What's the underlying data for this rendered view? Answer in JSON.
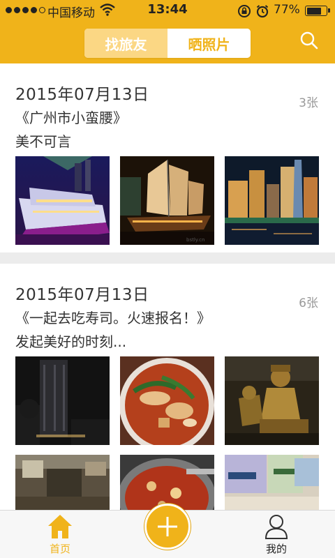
{
  "status_bar": {
    "carrier": "中国移动",
    "time": "13:44",
    "battery": "77%",
    "battery_level": 0.77
  },
  "header": {
    "tabs": [
      {
        "label": "找旅友",
        "active": false
      },
      {
        "label": "晒照片",
        "active": true
      }
    ],
    "search_icon": "search-icon"
  },
  "posts": [
    {
      "date": "2015年07月13日",
      "count": "3张",
      "title": "《广州市小蛮腰》",
      "desc": "美不可言",
      "photos": [
        "cruise-ship-night",
        "lit-junk-sailboat",
        "city-skyline-night"
      ]
    },
    {
      "date": "2015年07月13日",
      "count": "6张",
      "title": "《一起去吃寿司。火速报名！》",
      "desc": "发起美好的时刻...",
      "photos": [
        "night-skyscraper",
        "noodle-bowl",
        "bronze-statue",
        "restaurant-interior",
        "spicy-hotpot",
        "snack-packages"
      ]
    }
  ],
  "tabbar": {
    "home_label": "首页",
    "mine_label": "我的",
    "add_icon": "plus-icon"
  },
  "colors": {
    "accent": "#f0b31a",
    "tab_inactive_bg": "#fbd784",
    "text": "#333333",
    "muted": "#999999"
  }
}
